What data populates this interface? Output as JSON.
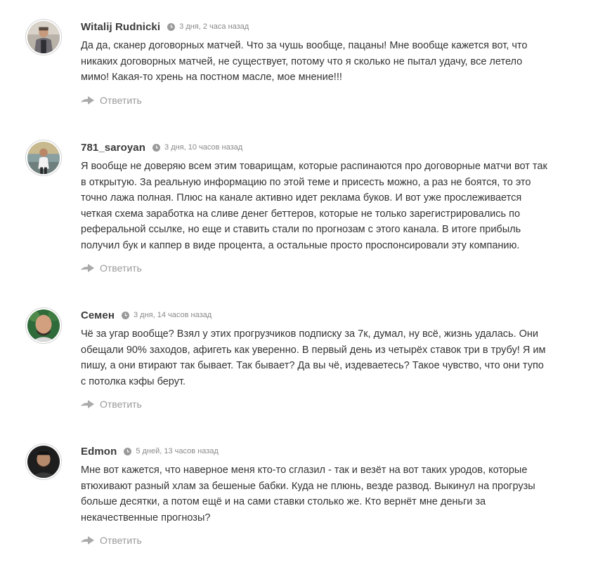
{
  "comments": [
    {
      "author": "Witalij Rudnicki",
      "date": "3 дня, 2 часа назад",
      "text": "Да да, сканер договорных матчей. Что за чушь вообще, пацаны! Мне вообще кажется вот, что никаких договорных матчей, не существует, потому что я сколько не пытал удачу, все летело мимо! Какая-то хрень на постном масле, мое мнение!!!",
      "reply_label": "Ответить"
    },
    {
      "author": "781_saroyan",
      "date": "3 дня, 10 часов назад",
      "text": "Я вообще не доверяю всем этим товарищам, которые распинаются про договорные матчи вот так в открытую. За реальную информацию по этой теме и присесть можно, а раз не боятся, то это точно лажа полная. Плюс на канале активно идет реклама буков. И вот уже прослеживается четкая схема заработка на сливе денег беттеров, которые не только зарегистрировались по реферальной ссылке, но еще и ставить стали по прогнозам с этого канала. В итоге прибыль получил бук и каппер в виде процента, а остальные просто проспонсировали эту компанию.",
      "reply_label": "Ответить"
    },
    {
      "author": "Семен",
      "date": "3 дня, 14 часов назад",
      "text": "Чё за угар вообще? Взял у этих прогрузчиков подписку за 7к, думал, ну всё, жизнь удалась. Они обещали 90% заходов, афигеть как уверенно. В первый день из четырёх ставок три в трубу! Я им пишу, а они втирают так бывает. Так бывает? Да вы чё, издеваетесь? Такое чувство, что они тупо с потолка кэфы берут.",
      "reply_label": "Ответить"
    },
    {
      "author": "Edmon",
      "date": "5 дней, 13 часов назад",
      "text": "Мне вот кажется, что наверное меня кто-то сглазил - так и везёт на вот таких уродов, которые втюхивают разный хлам за бешеные бабки. Куда не плюнь, везде развод. Выкинул на прогрузы больше десятки, а потом ещё и на сами ставки столько же. Кто вернёт мне деньги за некачественные прогнозы?",
      "reply_label": "Ответить"
    }
  ]
}
